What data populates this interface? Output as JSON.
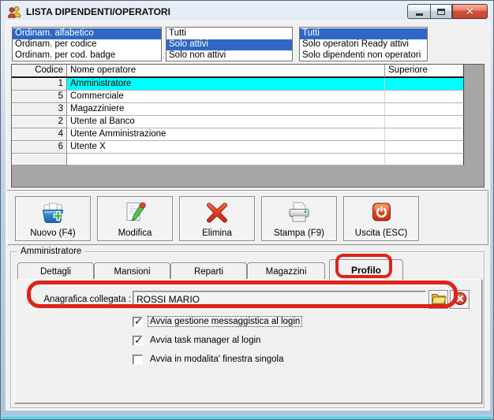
{
  "window": {
    "title": "LISTA DIPENDENTI/OPERATORI",
    "controls": [
      "minimize",
      "maximize",
      "close"
    ]
  },
  "filters": {
    "ordering": {
      "items": [
        "Ordinam. alfabetico",
        "Ordinam. per codice",
        "Ordinam. per cod. badge"
      ],
      "selected": "Ordinam. alfabetico"
    },
    "status": {
      "items": [
        "Tutti",
        "Solo attivi",
        "Solo non attivi"
      ],
      "selected": "Solo attivi"
    },
    "category": {
      "items": [
        "Tutti",
        "Solo operatori Ready attivi",
        "Solo dipendenti non operatori"
      ],
      "selected": "Tutti"
    }
  },
  "grid": {
    "columns": {
      "codice": "Codice",
      "nome": "Nome operatore",
      "superiore": "Superiore"
    },
    "rows": [
      {
        "codice": "1",
        "nome": "Amministratore",
        "superiore": "",
        "selected": true
      },
      {
        "codice": "5",
        "nome": "Commerciale",
        "superiore": "",
        "selected": false
      },
      {
        "codice": "3",
        "nome": "Magazziniere",
        "superiore": "",
        "selected": false
      },
      {
        "codice": "2",
        "nome": "Utente al Banco",
        "superiore": "",
        "selected": false
      },
      {
        "codice": "4",
        "nome": "Utente Amministrazione",
        "superiore": "",
        "selected": false
      },
      {
        "codice": "6",
        "nome": "Utente X",
        "superiore": "",
        "selected": false
      }
    ]
  },
  "toolbar": {
    "buttons": [
      {
        "label": "Nuovo (F4)",
        "icon": "new-icon"
      },
      {
        "label": "Modifica",
        "icon": "edit-icon"
      },
      {
        "label": "Elimina",
        "icon": "delete-icon"
      },
      {
        "label": "Stampa (F9)",
        "icon": "print-icon"
      },
      {
        "label": "Uscita (ESC)",
        "icon": "exit-icon"
      }
    ]
  },
  "detail": {
    "group_label": "Amministratore",
    "tabs": [
      {
        "label": "Dettagli",
        "active": false
      },
      {
        "label": "Mansioni",
        "active": false
      },
      {
        "label": "Reparti",
        "active": false
      },
      {
        "label": "Magazzini",
        "active": false
      },
      {
        "label": "Profilo",
        "active": true
      }
    ],
    "anagrafica": {
      "label": "Anagrafica collegata :",
      "value": "ROSSI MARIO"
    },
    "checkboxes": [
      {
        "label": "Avvia gestione messaggistica al login",
        "checked": true,
        "focused": true
      },
      {
        "label": "Avvia task manager al login",
        "checked": true,
        "focused": false
      },
      {
        "label": "Avvia in modalita' finestra singola",
        "checked": false,
        "focused": false
      }
    ]
  },
  "colors": {
    "selection_blue": "#2f67c4",
    "selection_cyan": "#00ffff",
    "annotation_red": "#df2318",
    "window_bg": "#f0f0f0"
  }
}
